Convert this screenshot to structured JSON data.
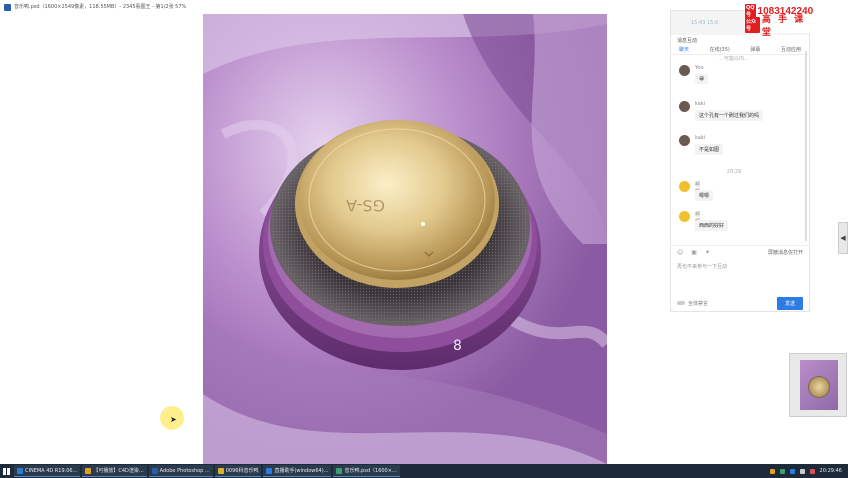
{
  "window": {
    "title": "音乐鸭.psd（1600×2549像素，118.55MB）- 2345看图王 - 第1/2张 57%"
  },
  "chat": {
    "signal": "15:43 15:0",
    "promo": {
      "qq_tag": "QQ号",
      "qq_number": "1083142240",
      "wechat_tag": "公众号",
      "brand": "高 手 课 堂"
    },
    "header": "消息互动",
    "tabs": [
      "聊天",
      "在线(35)",
      "弹幕",
      "互动应用"
    ],
    "messages": [
      {
        "sender": "Yoo",
        "text": "😀",
        "avatar": "photo"
      },
      {
        "sender": "kaki",
        "text": "这个孔有一个刷过我们的吗",
        "avatar": "photo"
      },
      {
        "sender": "kaki",
        "text": "不是如图",
        "avatar": "photo"
      },
      {
        "sender": "啊啊啊",
        "text": "嗯嗯",
        "avatar": "emoji"
      },
      {
        "sender": "啊啊啊",
        "text": "西西的好好",
        "avatar": "emoji"
      }
    ],
    "time_separator": "20:29",
    "top_cut_text": "...可能以内...",
    "tools_right": "屏蔽消息仅打开",
    "input_placeholder": "再也不来参与一下互动",
    "footer_toggle_label": "全体禁言",
    "send_label": "发送"
  },
  "side_tab": {
    "arrow": "◀"
  },
  "taskbar": {
    "tasks": [
      {
        "label": "CINEMA 4D R19.06...",
        "color": "#2e7bd6"
      },
      {
        "label": "【可播放】C4D渲染...",
        "color": "#e0a020"
      },
      {
        "label": "Adobe Photoshop ...",
        "color": "#2b5ea8"
      },
      {
        "label": "0096科音乐鸭",
        "color": "#e0b030"
      },
      {
        "label": "直播助手(window64)...",
        "color": "#2d7be5"
      },
      {
        "label": "音乐鸭.psd（1600×...",
        "color": "#3aa070"
      }
    ],
    "clock": "20:29:46"
  }
}
